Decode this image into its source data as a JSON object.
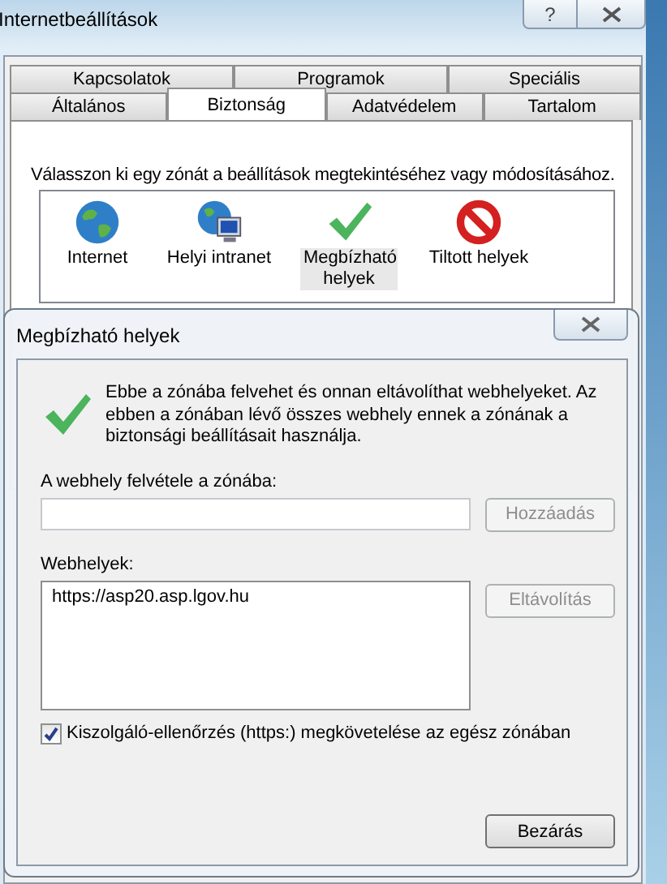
{
  "window": {
    "title": "Internetbeállítások",
    "help_button": "?"
  },
  "tab_rows": [
    [
      {
        "label": "Kapcsolatok",
        "selected": false
      },
      {
        "label": "Programok",
        "selected": false
      },
      {
        "label": "Speciális",
        "selected": false
      }
    ],
    [
      {
        "label": "Általános",
        "selected": false
      },
      {
        "label": "Biztonság",
        "selected": true
      },
      {
        "label": "Adatvédelem",
        "selected": false
      },
      {
        "label": "Tartalom",
        "selected": false
      }
    ]
  ],
  "instruction": "Válasszon ki egy zónát a beállítások megtekintéséhez vagy módosításához.",
  "zones": [
    {
      "label": "Internet",
      "kind": "globe",
      "selected": false
    },
    {
      "label": "Helyi intranet",
      "kind": "intranet",
      "selected": false
    },
    {
      "label": "Megbízható helyek",
      "kind": "trusted",
      "selected": true
    },
    {
      "label": "Tiltott helyek",
      "kind": "blocked",
      "selected": false
    }
  ],
  "dialog": {
    "title": "Megbízható helyek",
    "description": "Ebbe a zónába felvehet és onnan eltávolíthat webhelyeket. Az ebben a zónában lévő összes webhely ennek a zónának a biztonsági beállításait használja.",
    "add_label": "A webhely felvétele a zónába:",
    "add_button": {
      "label": "Hozzáadás",
      "disabled": true
    },
    "sites_label": "Webhelyek:",
    "sites": [
      "https://asp20.asp.lgov.hu"
    ],
    "remove_button": {
      "label": "Eltávolítás",
      "disabled": true
    },
    "https_checkbox": {
      "label": "Kiszolgáló-ellenőrzés (https:) megkövetelése az egész zónában",
      "checked": true
    },
    "close_button": "Bezárás"
  }
}
